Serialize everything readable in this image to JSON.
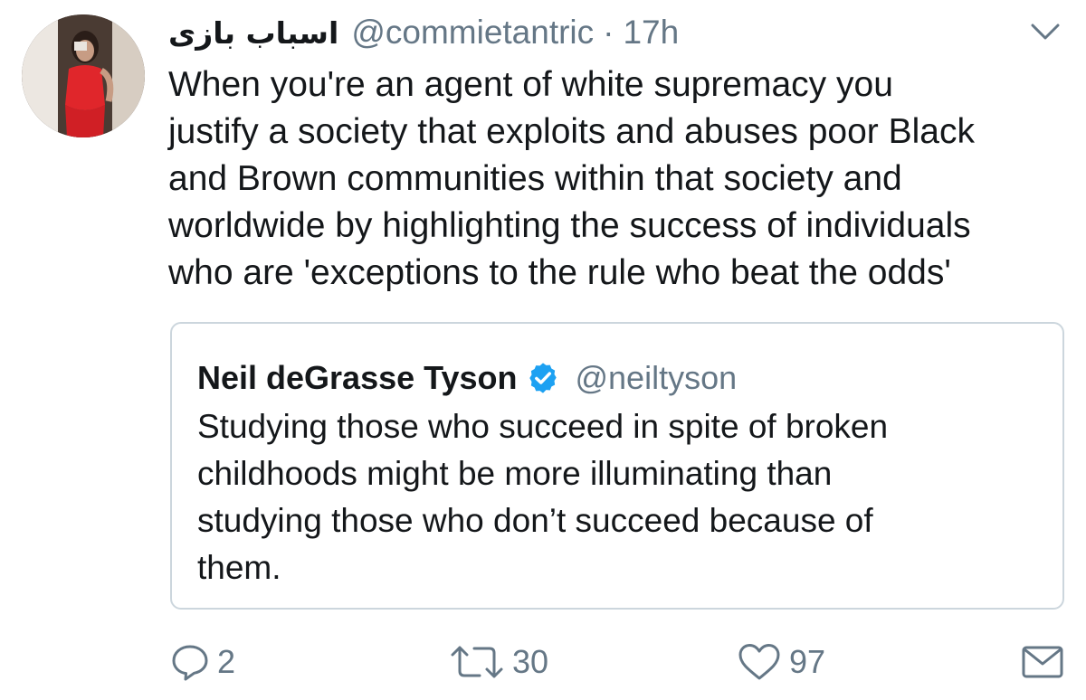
{
  "tweet": {
    "display_name": "اسباب بازی",
    "handle": "@commietantric",
    "separator": "·",
    "time": "17h",
    "text_lines": [
      "When you're an agent of white supremacy you",
      "justify a society that exploits and abuses poor Black",
      "and Brown communities within that society and",
      "worldwide by highlighting the success of individuals",
      "who are 'exceptions to the rule who beat the odds'"
    ]
  },
  "quote": {
    "name": "Neil deGrasse Tyson",
    "handle": "@neiltyson",
    "verified": true,
    "text_lines": [
      "Studying those who succeed in spite of broken",
      "childhoods might be more illuminating than",
      "studying those who don’t succeed because of",
      "them."
    ]
  },
  "actions": {
    "reply_count": "2",
    "retweet_count": "30",
    "like_count": "97"
  },
  "icons": {
    "caret": "chevron-down-icon",
    "verified": "verified-badge-icon",
    "reply": "reply-icon",
    "retweet": "retweet-icon",
    "like": "heart-icon",
    "message": "envelope-icon"
  },
  "colors": {
    "text": "#14171a",
    "secondary": "#657786",
    "verified_blue": "#1da1f2",
    "border": "#ccd6dd"
  }
}
